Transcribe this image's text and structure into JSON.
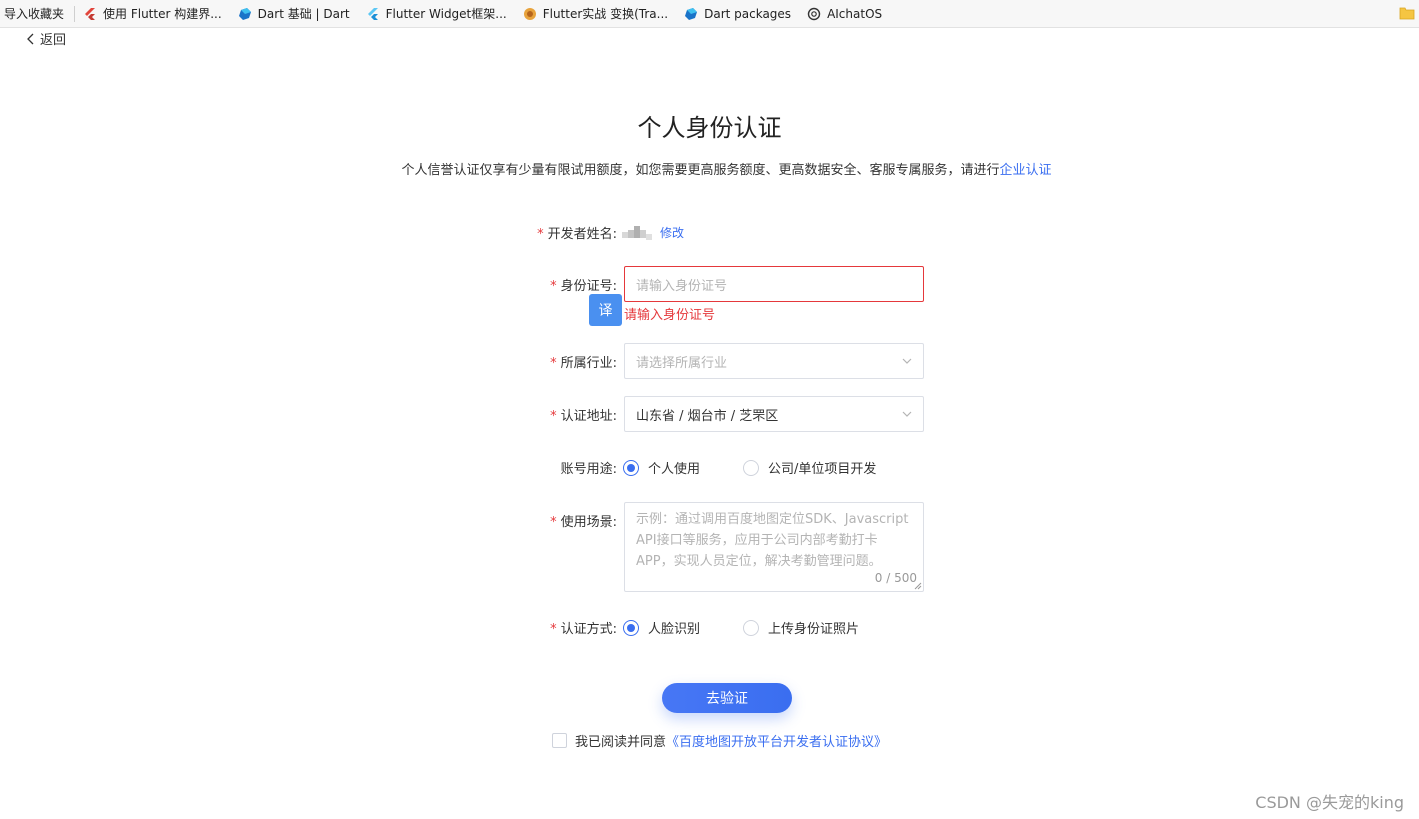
{
  "bookmarks": [
    {
      "label": "导入收藏夹",
      "icon": "none"
    },
    {
      "label": "使用 Flutter 构建界...",
      "icon": "flutter-red-icon"
    },
    {
      "label": "Dart 基础 | Dart",
      "icon": "dart-icon"
    },
    {
      "label": "Flutter Widget框架...",
      "icon": "flutter-icon"
    },
    {
      "label": "Flutter实战 变换(Tra...",
      "icon": "flutter-book-icon"
    },
    {
      "label": "Dart packages",
      "icon": "dart-icon"
    },
    {
      "label": "AIchatOS",
      "icon": "openai-icon"
    }
  ],
  "back_label": "返回",
  "title": "个人身份认证",
  "subtitle": {
    "text": "个人信誉认证仅享有少量有限试用额度，如您需要更高服务额度、更高数据安全、客服专属服务，请进行",
    "link": "企业认证"
  },
  "form": {
    "developer_name": {
      "label": "开发者姓名:",
      "edit": "修改"
    },
    "id_number": {
      "label": "身份证号:",
      "placeholder": "请输入身份证号",
      "error": "请输入身份证号",
      "translate_btn": "译"
    },
    "industry": {
      "label": "所属行业:",
      "placeholder": "请选择所属行业"
    },
    "address": {
      "label": "认证地址:",
      "value": "山东省 / 烟台市 / 芝罘区"
    },
    "usage": {
      "label": "账号用途:",
      "options": [
        "个人使用",
        "公司/单位项目开发"
      ],
      "selected": 0
    },
    "scenario": {
      "label": "使用场景:",
      "placeholder": "示例：通过调用百度地图定位SDK、Javascript API接口等服务，应用于公司内部考勤打卡APP，实现人员定位，解决考勤管理问题。",
      "counter": "0 / 500"
    },
    "method": {
      "label": "认证方式:",
      "options": [
        "人脸识别",
        "上传身份证照片"
      ],
      "selected": 0
    }
  },
  "submit_label": "去验证",
  "agreement": {
    "text": "我已阅读并同意",
    "link": "《百度地图开放平台开发者认证协议》"
  },
  "watermark": "CSDN @失宠的king",
  "colors": {
    "accent": "#3a6ef0",
    "error": "#e5383b"
  }
}
